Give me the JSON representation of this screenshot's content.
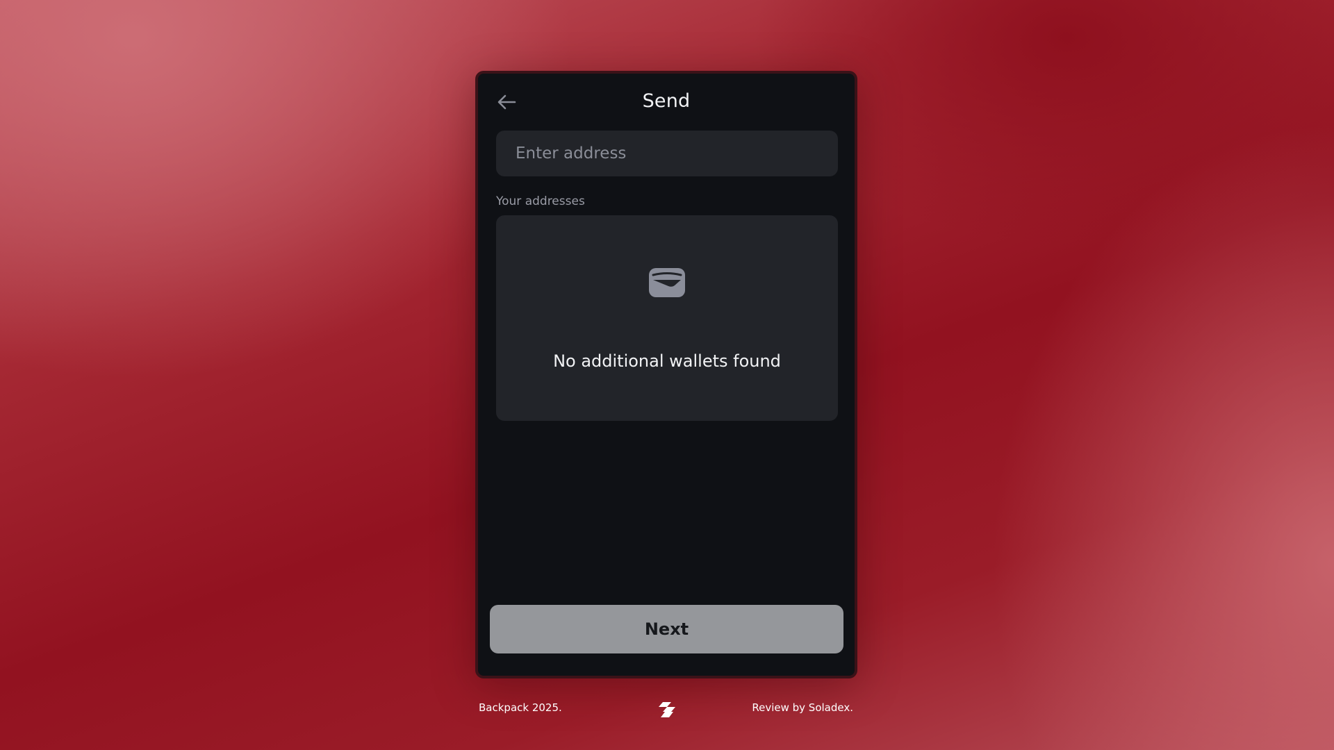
{
  "header": {
    "title": "Send",
    "back_icon": "arrow-left-icon"
  },
  "address_input": {
    "placeholder": "Enter address",
    "value": ""
  },
  "addresses_section": {
    "label": "Your addresses",
    "empty_icon": "wallet-icon",
    "empty_text": "No additional wallets found"
  },
  "actions": {
    "next_label": "Next"
  },
  "footer": {
    "left_text": "Backpack 2025.",
    "logo_icon": "soladex-logo-icon",
    "right_text": "Review by Soladex."
  },
  "colors": {
    "panel_bg": "#0f1115",
    "card_bg": "#222429",
    "button_bg": "#95979b",
    "background_red": "#921220"
  }
}
